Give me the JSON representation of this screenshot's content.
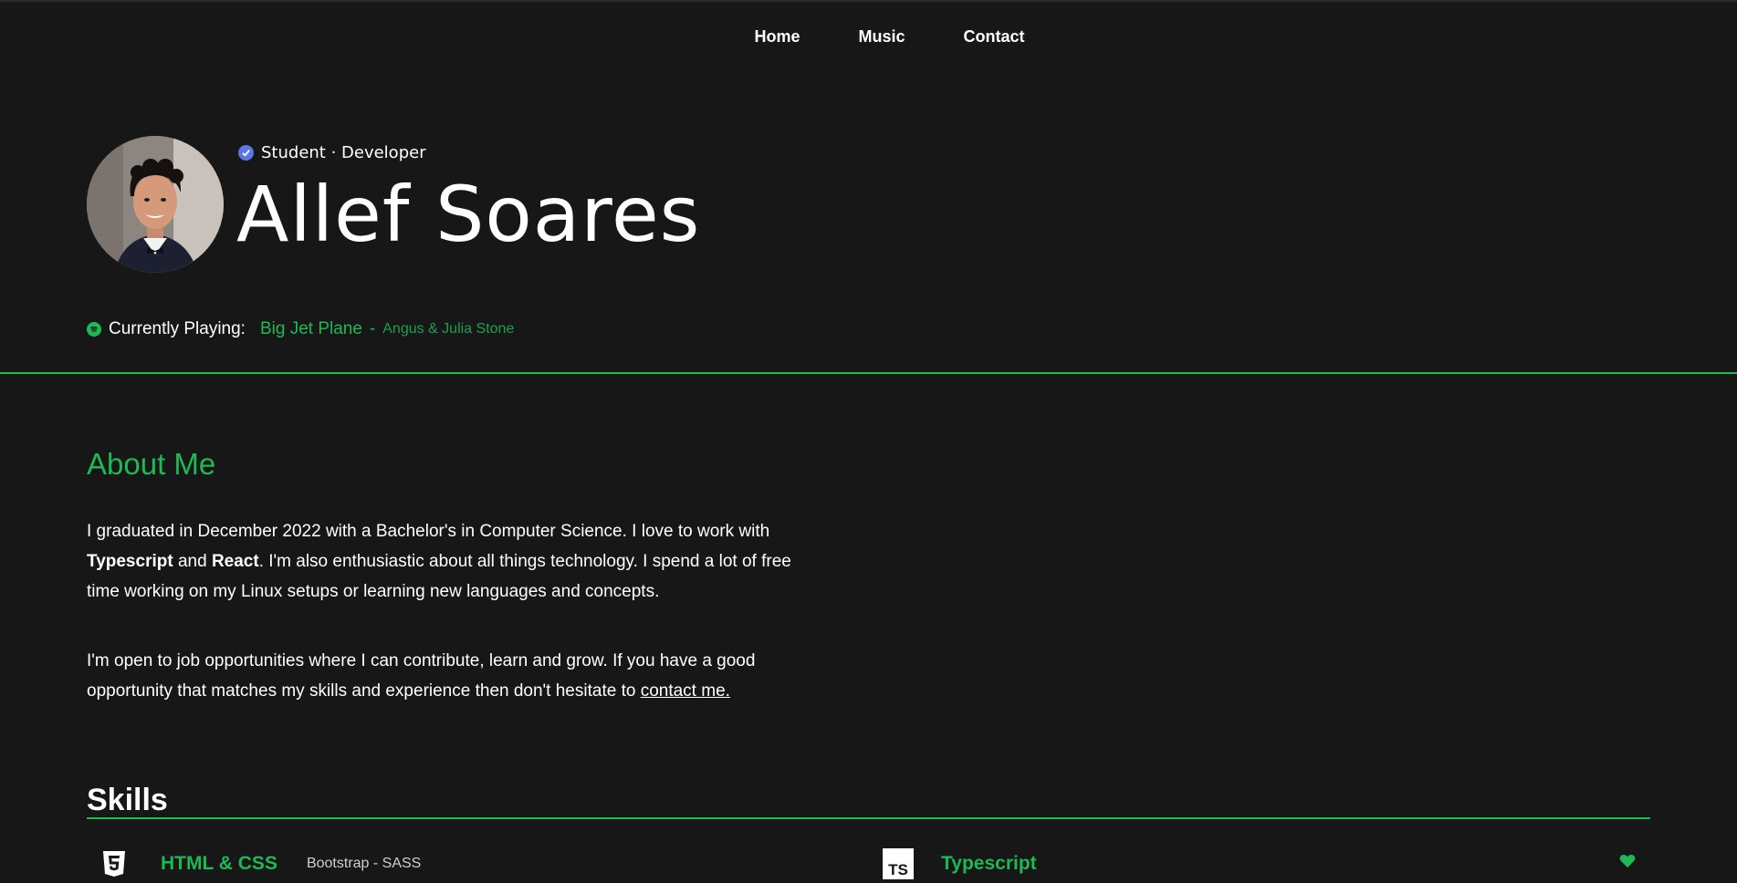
{
  "nav": {
    "items": [
      "Home",
      "Music",
      "Contact"
    ]
  },
  "hero": {
    "role": "Student · Developer",
    "name": "Allef Soares"
  },
  "now_playing": {
    "label": "Currently Playing:",
    "track": "Big Jet Plane",
    "separator": "-",
    "artist": "Angus & Julia Stone"
  },
  "about": {
    "title": "About Me",
    "p1_a": "I graduated in December 2022 with a Bachelor's in Computer Science. I love to work with ",
    "p1_b": "Typescript",
    "p1_c": " and ",
    "p1_d": "React",
    "p1_e": ". I'm also enthusiastic about all things technology. I spend a lot of free time working on my Linux setups or learning new languages and concepts.",
    "p2_a": "I'm open to job opportunities where I can contribute, learn and grow. If you have a good opportunity that matches my skills and experience then don't hesitate to ",
    "p2_link": "contact me."
  },
  "skills": {
    "title": "Skills",
    "items": [
      {
        "name": "HTML & CSS",
        "sub": "Bootstrap - SASS",
        "icon": "html5-icon"
      },
      {
        "name": "Typescript",
        "sub": "",
        "icon": "typescript-icon"
      }
    ]
  },
  "colors": {
    "accent": "#1db954",
    "background": "#171717",
    "verified": "#5b76e8"
  }
}
